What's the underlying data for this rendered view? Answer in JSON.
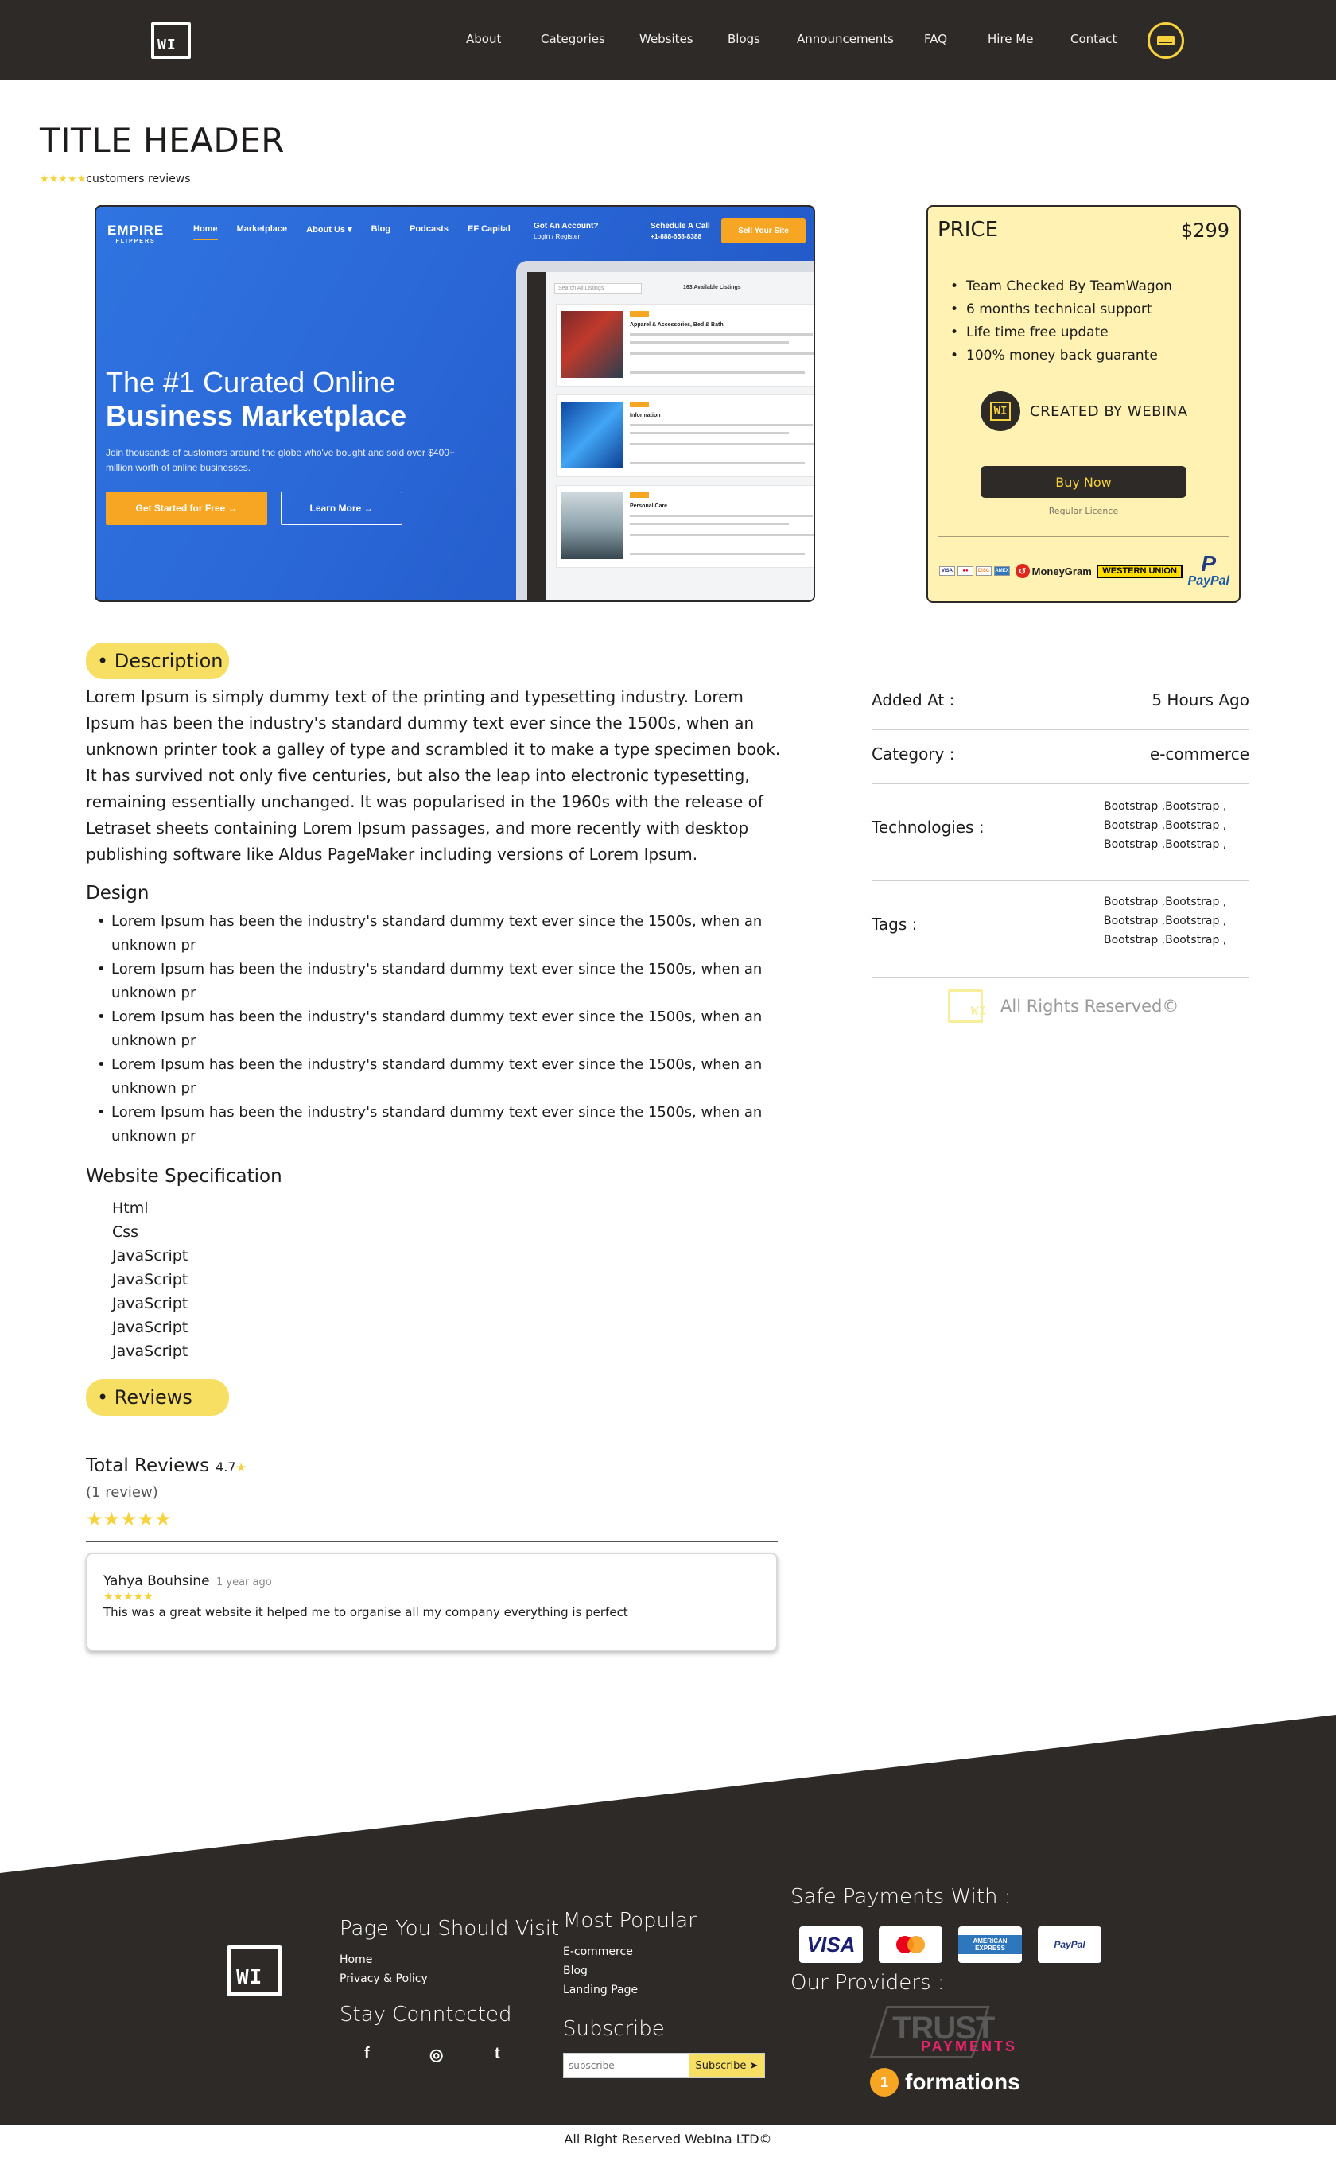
{
  "nav": {
    "logo_text": "WI",
    "links": [
      "About",
      "Categories",
      "Websites",
      "Blogs",
      "Announcements",
      "FAQ",
      "Hire Me",
      "Contact"
    ]
  },
  "product": {
    "title": "TITLE HEADER",
    "stars": "★★★★★",
    "reviews_label": "customers reviews"
  },
  "preview": {
    "brand": "EMPIRE",
    "brand_sub": "FLIPPERS",
    "nav": [
      "Home",
      "Marketplace",
      "About Us ▾",
      "Blog",
      "Podcasts",
      "EF Capital"
    ],
    "account_title": "Got An Account?",
    "account_sub": "Login / Register",
    "call_title": "Schedule A Call",
    "call_sub": "+1-888-658-8388",
    "sell_button": "Sell Your Site",
    "headline_1": "The #1 Curated Online",
    "headline_2": "Business Marketplace",
    "subtext": "Join thousands of customers around the globe who've bought and sold over $400+ million worth of online businesses.",
    "cta_primary": "Get Started for Free →",
    "cta_secondary": "Learn More →",
    "search_placeholder": "Search All Listings",
    "listing_count": "163 Available Listings",
    "cards": [
      "Apparel & Accessories, Bed & Bath",
      "Information",
      "Personal Care"
    ]
  },
  "price_card": {
    "label": "PRICE",
    "value": "$299",
    "features": [
      "Team Checked By TeamWagon",
      "6 months technical support",
      "Life time free update",
      "100% money back guarante"
    ],
    "creator_logo": "WI",
    "creator": "CREATED BY WEBINA",
    "buy_button": "Buy Now",
    "licence": "Regular Licence",
    "payments": {
      "moneygram": "MoneyGram",
      "western_union": "WESTERN UNION",
      "paypal": "PayPal"
    }
  },
  "description": {
    "pill": "• Description",
    "text": "Lorem Ipsum is simply dummy text of the printing and typesetting industry. Lorem Ipsum has been the industry's standard dummy text ever since the 1500s, when an unknown printer took a galley of type and scrambled it to make a type specimen book. It has survived not only five centuries, but also the leap into electronic typesetting, remaining essentially unchanged. It was popularised in the 1960s with the release of Letraset sheets containing Lorem Ipsum passages, and more recently with desktop publishing software like Aldus PageMaker including versions of Lorem Ipsum.",
    "design_heading": "Design",
    "design_items": [
      "Lorem Ipsum has been the industry's standard dummy text ever since the 1500s, when an unknown pr",
      "Lorem Ipsum has been the industry's standard dummy text ever since the 1500s, when an unknown pr",
      "Lorem Ipsum has been the industry's standard dummy text ever since the 1500s, when an unknown pr",
      "Lorem Ipsum has been the industry's standard dummy text ever since the 1500s, when an unknown pr",
      "Lorem Ipsum has been the industry's standard dummy text ever since the 1500s, when an unknown pr"
    ],
    "spec_heading": "Website Specification",
    "spec_items": [
      "Html",
      "Css",
      "JavaScript",
      "JavaScript",
      "JavaScript",
      "JavaScript",
      "JavaScript"
    ]
  },
  "reviews": {
    "pill": "• Reviews",
    "total_label": "Total Reviews",
    "average": "4.7",
    "count": "(1 review)",
    "stars": "★★★★★",
    "items": [
      {
        "name": "Yahya Bouhsine",
        "time": "1 year ago",
        "stars": "★★★★★",
        "text": "This was a great website it helped me to organise all my company everything is perfect"
      }
    ]
  },
  "info": {
    "added_label": "Added At :",
    "added_value": "5 Hours Ago",
    "category_label": "Category :",
    "category_value": "e-commerce",
    "technologies_label": "Technologies :",
    "technologies_lines": [
      "Bootstrap ,Bootstrap ,",
      "Bootstrap ,Bootstrap ,",
      "Bootstrap ,Bootstrap ,"
    ],
    "tags_label": "Tags :",
    "tags_lines": [
      "Bootstrap ,Bootstrap ,",
      "Bootstrap ,Bootstrap ,",
      "Bootstrap ,Bootstrap ,"
    ],
    "reserved": "All Rights Reserved©"
  },
  "footer": {
    "logo_text": "WI",
    "visit_heading": "Page You Should Visit",
    "visit_links": [
      "Home",
      "Privacy & Policy"
    ],
    "connected_heading": "Stay Conntected",
    "social": [
      "f",
      "◎",
      "t"
    ],
    "popular_heading": "Most Popular",
    "popular_links": [
      "E-commerce",
      "Blog",
      "Landing Page"
    ],
    "subscribe_heading": "Subscribe",
    "subscribe_placeholder": "subscribe",
    "subscribe_button": "Subscribe ➤",
    "payments_heading": "Safe Payments With :",
    "payment_cards": [
      "VISA",
      "mastercard",
      "AMERICAN EXPRESS",
      "PayPal"
    ],
    "providers_heading": "Our Providers :",
    "provider_trust": "TRUST",
    "provider_trust_sub": "PAYMENTS",
    "provider_formations": "formations",
    "copyright": "All Right Reserved WebIna LTD©"
  },
  "colors": {
    "dark": "#2e2a27",
    "accent_yellow": "#f6d23d",
    "price_bg": "#fff2b3",
    "pill_bg": "#f6df63"
  }
}
